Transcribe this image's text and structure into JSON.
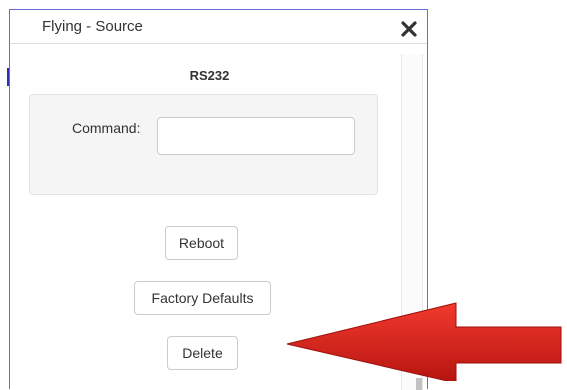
{
  "dialog": {
    "title": "Flying - Source",
    "close_icon": "close-x-icon"
  },
  "rs232": {
    "title": "RS232",
    "command_label": "Command:",
    "command_value": ""
  },
  "buttons": {
    "reboot": "Reboot",
    "factory_defaults": "Factory Defaults",
    "delete": "Delete"
  },
  "colors": {
    "arrow": "#e8231f",
    "dialog_border": "#6b6bd6"
  },
  "annotation": {
    "icon": "red-pointer-arrow-icon"
  }
}
